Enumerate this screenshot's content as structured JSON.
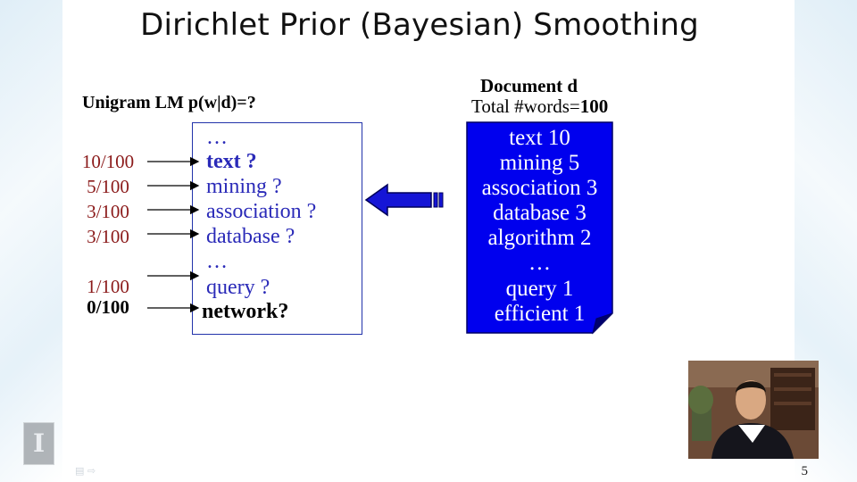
{
  "slide": {
    "title": "Dirichlet Prior (Bayesian) Smoothing",
    "page_number": "5"
  },
  "unigram": {
    "label": "Unigram LM  p(w|d)=?"
  },
  "language_model": {
    "lines": [
      {
        "text": "…",
        "style": "normal"
      },
      {
        "text": "text  ?",
        "style": "bold"
      },
      {
        "text": "mining ?",
        "style": "normal"
      },
      {
        "text": "association ?",
        "style": "normal"
      },
      {
        "text": "database ?",
        "style": "normal"
      },
      {
        "text": "…",
        "style": "normal"
      },
      {
        "text": "query ?",
        "style": "normal"
      },
      {
        "text": "network?",
        "style": "dark"
      }
    ],
    "probabilities": [
      "10/100",
      "5/100",
      "3/100",
      "3/100",
      "1/100",
      "0/100"
    ]
  },
  "document": {
    "label": "Document  d",
    "total_prefix": "Total #words=",
    "total_value": "100",
    "words": [
      "text 10",
      "mining 5",
      "association 3",
      "database 3",
      "algorithm 2",
      "…",
      "query 1",
      "efficient 1"
    ]
  },
  "colors": {
    "doc_fill": "#0000ee",
    "lm_text": "#2a2ab8",
    "prob_text": "#8b1a1a"
  },
  "icons": {
    "logo": "illinois-logo-icon",
    "nav": "slide-nav-icon"
  }
}
